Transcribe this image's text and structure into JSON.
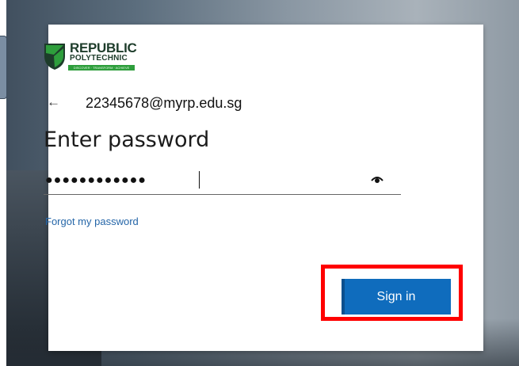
{
  "logo": {
    "line1": "REPUBLIC",
    "line2": "POLYTECHNIC",
    "tagline": "DISCOVER · TRANSFORM · ACHIEVE",
    "colors": {
      "green": "#2e9e3c",
      "dark": "#1d3c2a"
    }
  },
  "identity": {
    "back_icon": "arrow-left-icon",
    "email": "22345678@myrp.edu.sg"
  },
  "form": {
    "title": "Enter password",
    "password_masked": "●●●●●●●●●●●●",
    "reveal_icon": "eye-icon",
    "forgot_link": "Forgot my password",
    "sign_in_label": "Sign in"
  },
  "colors": {
    "primary": "#0f6cbd",
    "link": "#2566a8",
    "highlight": "#ff0000"
  }
}
